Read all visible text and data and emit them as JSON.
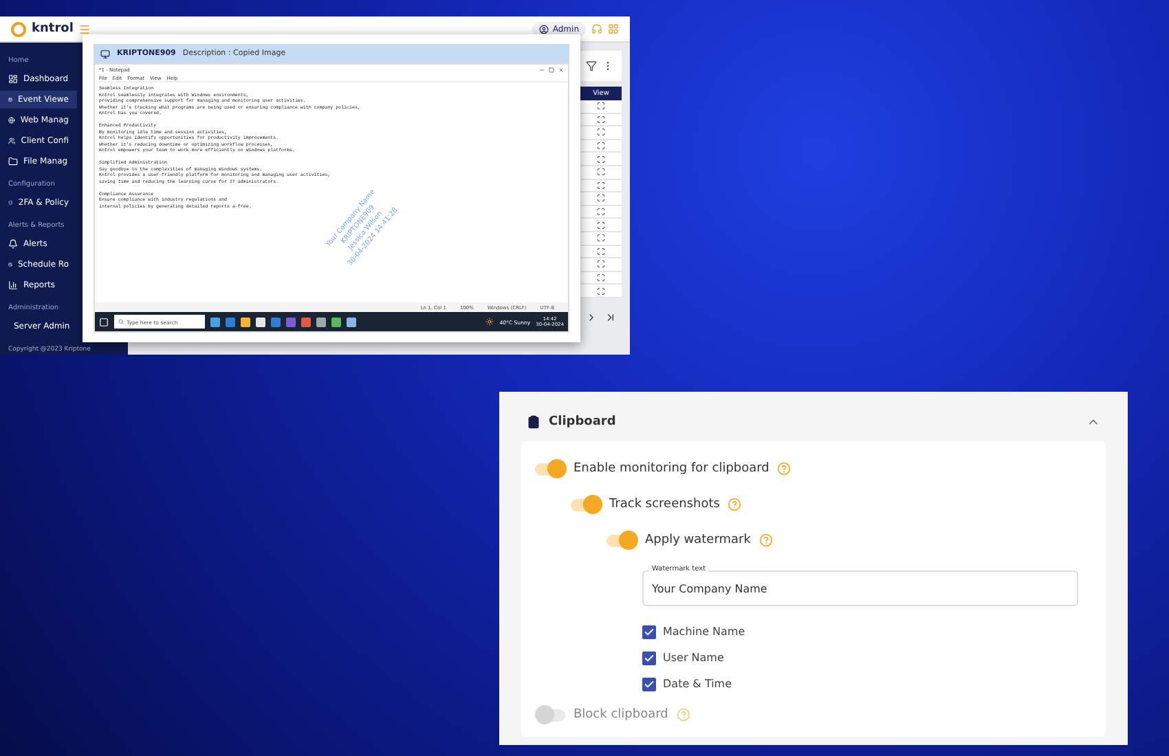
{
  "app": {
    "logo": "kntrol",
    "admin": "Admin",
    "sidebar": [
      {
        "heading": "Home",
        "items": [
          {
            "label": "Dashboard",
            "selected": false
          },
          {
            "label": "Event Viewe",
            "selected": true
          },
          {
            "label": "Web Manag",
            "selected": false
          },
          {
            "label": "Client Confi",
            "selected": false
          },
          {
            "label": "File Manag",
            "selected": false
          }
        ]
      },
      {
        "heading": "Configuration",
        "items": [
          {
            "label": "2FA & Policy",
            "selected": false
          }
        ]
      },
      {
        "heading": "Alerts & Reports",
        "items": [
          {
            "label": "Alerts",
            "selected": false
          },
          {
            "label": "Schedule Ro",
            "selected": false
          },
          {
            "label": "Reports",
            "selected": false
          }
        ]
      },
      {
        "heading": "Administration",
        "items": [
          {
            "label": "Server Admin",
            "selected": false
          }
        ]
      }
    ],
    "copyright": "Copyright @2023 Kriptone",
    "table": {
      "columns": [
        "View"
      ]
    }
  },
  "dialog": {
    "machine": "KRIPTONE909",
    "description": "Description : Copied Image",
    "notepad": {
      "title": "*1 - Notepad",
      "menu": [
        "File",
        "Edit",
        "Format",
        "View",
        "Help"
      ],
      "paragraphs": [
        {
          "heading": "Seamless Integration",
          "lines": [
            "Kntrol seamlessly integrates with Windows environments,",
            "providing comprehensive support for managing and monitoring user activities.",
            "Whether it's tracking what programs are being used or ensuring compliance with company policies,",
            "Kntrol has you covered."
          ]
        },
        {
          "heading": "Enhanced Productivity",
          "lines": [
            "By monitoring idle time and session activities,",
            "Kntrol helps identify opportunities for productivity improvements.",
            "Whether it's reducing downtime or optimizing workflow processes,",
            "Kntrol empowers your team to work more efficiently on Windows platforms."
          ]
        },
        {
          "heading": "Simplified Administration",
          "lines": [
            "Say goodbye to the complexities of managing Windows systems.",
            "Kntrol provides a user-friendly platform for monitoring and managing user activities,",
            "saving time and reducing the learning curve for IT administrators."
          ]
        },
        {
          "heading": "Compliance Assurance",
          "lines": [
            "Ensure compliance with industry regulations and",
            "internal policies by generating detailed reports a-free."
          ]
        }
      ],
      "watermark": [
        "Your Company Name",
        "KRIPTONE909",
        "Jessica Wilson",
        "30-04-2024 14:41:28"
      ],
      "status": [
        "Ln 1, Col 1",
        "100%",
        "Windows (CRLF)",
        "UTF-8"
      ]
    },
    "taskbar": {
      "search": "Type here to search",
      "weather": "40°C Sunny",
      "time": "14:42",
      "date": "30-04-2024"
    }
  },
  "clipboard": {
    "title": "Clipboard",
    "settings": [
      {
        "kind": "toggle",
        "label": "Enable monitoring for clipboard",
        "on": true,
        "disabled": false,
        "children": [
          {
            "kind": "toggle",
            "label": "Track screenshots",
            "on": true,
            "disabled": false,
            "children": [
              {
                "kind": "toggle",
                "label": "Apply watermark",
                "on": true,
                "disabled": false,
                "children": [
                  {
                    "kind": "field",
                    "label": "Watermark text",
                    "value": "Your Company Name"
                  },
                  {
                    "kind": "checkbox",
                    "label": "Machine Name",
                    "checked": true
                  },
                  {
                    "kind": "checkbox",
                    "label": "User Name",
                    "checked": true
                  },
                  {
                    "kind": "checkbox",
                    "label": "Date & Time",
                    "checked": true
                  }
                ]
              }
            ]
          }
        ]
      },
      {
        "kind": "toggle",
        "label": "Block clipboard",
        "on": false,
        "disabled": true
      }
    ]
  }
}
